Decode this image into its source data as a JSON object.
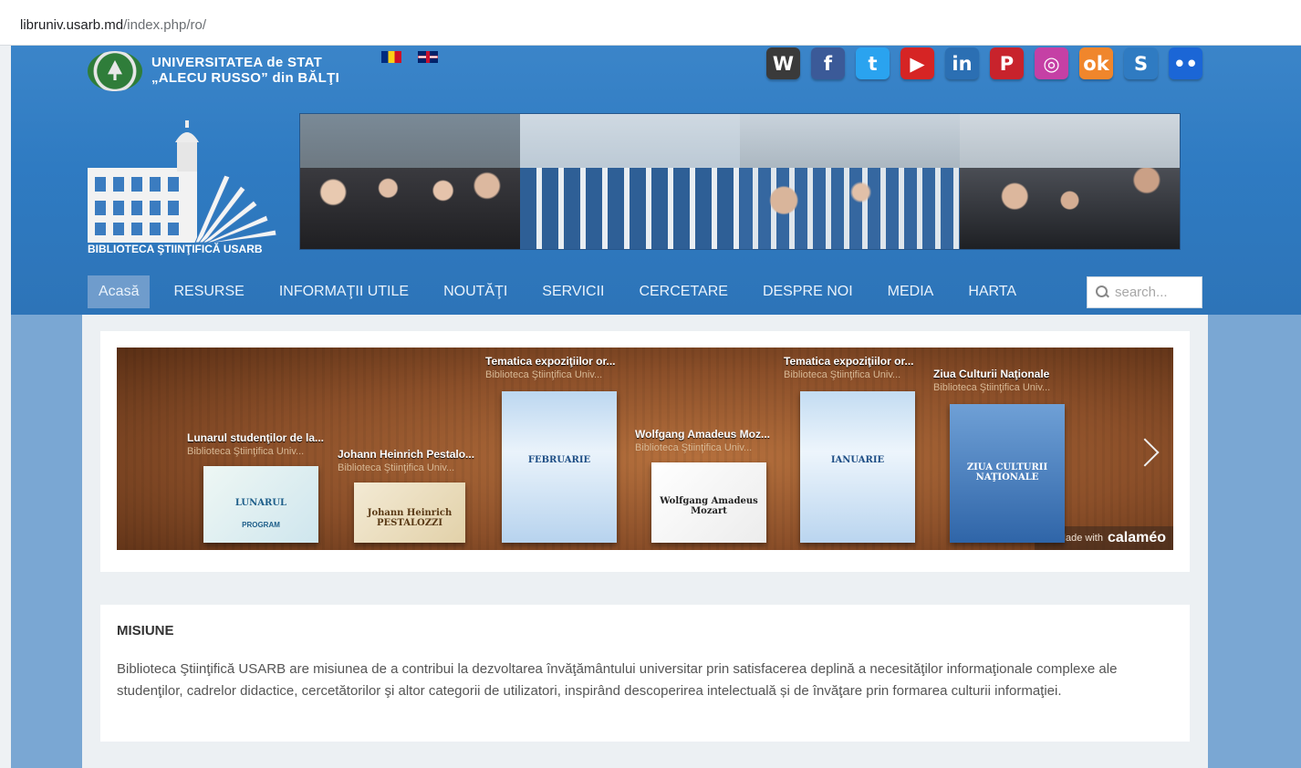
{
  "browser": {
    "url_host": "libruniv.usarb.md",
    "url_path": "/index.php/ro/"
  },
  "header": {
    "university_line1": "UNIVERSITATEA de STAT",
    "university_line2": "„ALECU RUSSO” din BĂLŢI",
    "library_label": "BIBLIOTECA ŞTIINŢIFICĂ USARB",
    "languages": [
      "ro-flag-icon",
      "uk-flag-icon"
    ],
    "social": [
      {
        "name": "wikipedia-icon",
        "glyph": "W",
        "color": "#3a3a3a"
      },
      {
        "name": "facebook-icon",
        "glyph": "f",
        "color": "#3b5a98"
      },
      {
        "name": "twitter-icon",
        "glyph": "t",
        "color": "#2aa3ef"
      },
      {
        "name": "youtube-icon",
        "glyph": "▶",
        "color": "#d62424"
      },
      {
        "name": "linkedin-icon",
        "glyph": "in",
        "color": "#2b6fb3"
      },
      {
        "name": "pinterest-icon",
        "glyph": "P",
        "color": "#c8232c"
      },
      {
        "name": "instagram-icon",
        "glyph": "◎",
        "color": "#c540a5"
      },
      {
        "name": "odnoklassniki-icon",
        "glyph": "ok",
        "color": "#f0862c"
      },
      {
        "name": "skype-icon",
        "glyph": "S",
        "color": "#2f7bc2"
      },
      {
        "name": "flickr-icon",
        "glyph": "••",
        "color": "#1b66d6"
      }
    ]
  },
  "nav": {
    "items": [
      "Acasă",
      "RESURSE",
      "INFORMAŢII UTILE",
      "NOUTĂŢI",
      "SERVICII",
      "CERCETARE",
      "DESPRE NOI",
      "MEDIA",
      "HARTA"
    ],
    "search_placeholder": "search..."
  },
  "shelf": {
    "books": [
      {
        "title": "Lunarul studenţilor de la...",
        "subtitle": "Biblioteca Ştiinţifica Univ...",
        "cover_text": "LUNARUL",
        "cover_sub": "PROGRAM"
      },
      {
        "title": "Johann Heinrich Pestalo...",
        "subtitle": "Biblioteca Ştiinţifica Univ...",
        "cover_text": "Johann Heinrich PESTALOZZI"
      },
      {
        "title": "Tematica expoziţiilor or...",
        "subtitle": "Biblioteca Ştiinţifica Univ...",
        "cover_text": "FEBRUARIE"
      },
      {
        "title": "Wolfgang Amadeus Moz...",
        "subtitle": "Biblioteca Ştiinţifica Univ...",
        "cover_text": "Wolfgang Amadeus Mozart"
      },
      {
        "title": "Tematica expoziţiilor or...",
        "subtitle": "Biblioteca Ştiinţifica Univ...",
        "cover_text": "IANUARIE"
      },
      {
        "title": "Ziua Culturii Naţionale",
        "subtitle": "Biblioteca Ştiinţifica Univ...",
        "cover_text": "ZIUA CULTURII NAŢIONALE"
      }
    ],
    "made_with": "Made with",
    "brand": "calaméo"
  },
  "mission": {
    "heading": "MISIUNE",
    "text": "Biblioteca Ştiinţifică USARB are misiunea de a contribui la dezvoltarea învăţământului universitar prin satisfacerea deplină a necesităţilor informaţionale complexe ale studenţilor, cadrelor didactice, cercetătorilor şi altor categorii de utilizatori, inspirând descoperirea intelectuală și de învăţare prin formarea culturii informaţiei."
  }
}
